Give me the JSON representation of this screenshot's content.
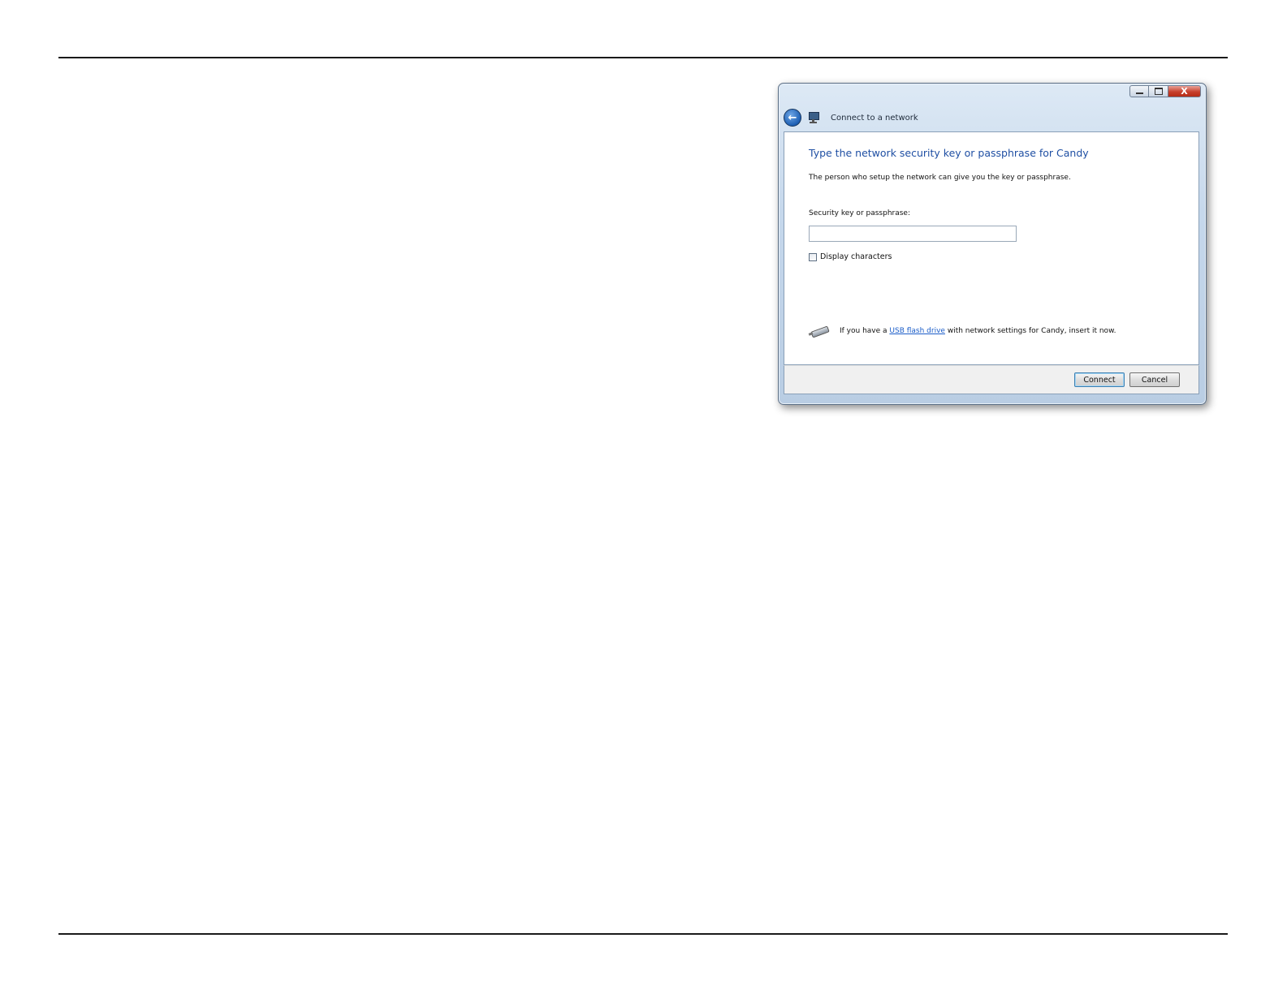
{
  "window": {
    "title": "Connect to a network",
    "caption": {
      "minimize_icon": "minimize-icon",
      "maximize_icon": "maximize-icon",
      "close_glyph": "X"
    }
  },
  "nav": {
    "back_glyph": "←",
    "back_icon": "back-arrow-icon",
    "network_icon": "network-icon"
  },
  "dialog": {
    "heading": "Type the network security key or passphrase for Candy",
    "subtext": "The person who setup the network can give you the key or passphrase.",
    "field_label": "Security key or passphrase:",
    "key_value": "",
    "checkbox_label": "Display characters",
    "checkbox_checked": false,
    "usb": {
      "prefix": "If you have a ",
      "link": "USB flash drive",
      "suffix": " with network settings for Candy, insert it now."
    }
  },
  "footer": {
    "connect_label": "Connect",
    "cancel_label": "Cancel"
  },
  "colors": {
    "heading": "#1f4fa3",
    "link": "#1a5cc8",
    "frame": "#c6d8ec"
  }
}
